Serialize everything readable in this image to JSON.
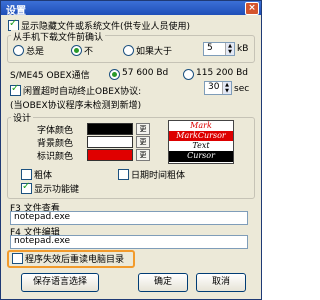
{
  "window": {
    "title": "设置",
    "close": "×"
  },
  "options": {
    "show_hidden": "显示隐藏文件或系统文件(供专业人员使用)",
    "download_group": "从手机下载文件前确认",
    "radio_always": "总是",
    "radio_never": "不",
    "radio_if_larger": "如果大于",
    "size_value": "5",
    "size_unit": "kB"
  },
  "obex": {
    "rate_label": "S/ME45 OBEX通信",
    "rate_57600": "57 600 Bd",
    "rate_115200": "115 200 Bd",
    "timeout_label": "闲置超时自动终止OBEX协议:",
    "timeout_value": "30",
    "timeout_unit": "sec",
    "note": "(当OBEX协议程序未检测到新增)"
  },
  "design": {
    "group": "设计",
    "font_color": "字体颜色",
    "bg_color": "背景颜色",
    "mark_color": "标识颜色",
    "change": "更",
    "bold": "粗体",
    "date_bold": "日期时间粗体",
    "show_func_keys": "显示功能键",
    "preview": {
      "mark": "Mark",
      "markcursor": "MarkCursor",
      "text": "Text",
      "cursor": "Cursor"
    }
  },
  "viewer": {
    "label": "F3   文件查看",
    "value": "notepad.exe"
  },
  "editor": {
    "label": "F4   文件编辑",
    "value": "notepad.exe"
  },
  "restart": {
    "label": "程序失效后重读电脑目录"
  },
  "buttons": {
    "save_lang": "保存语言选择",
    "ok": "确定",
    "cancel": "取消"
  }
}
